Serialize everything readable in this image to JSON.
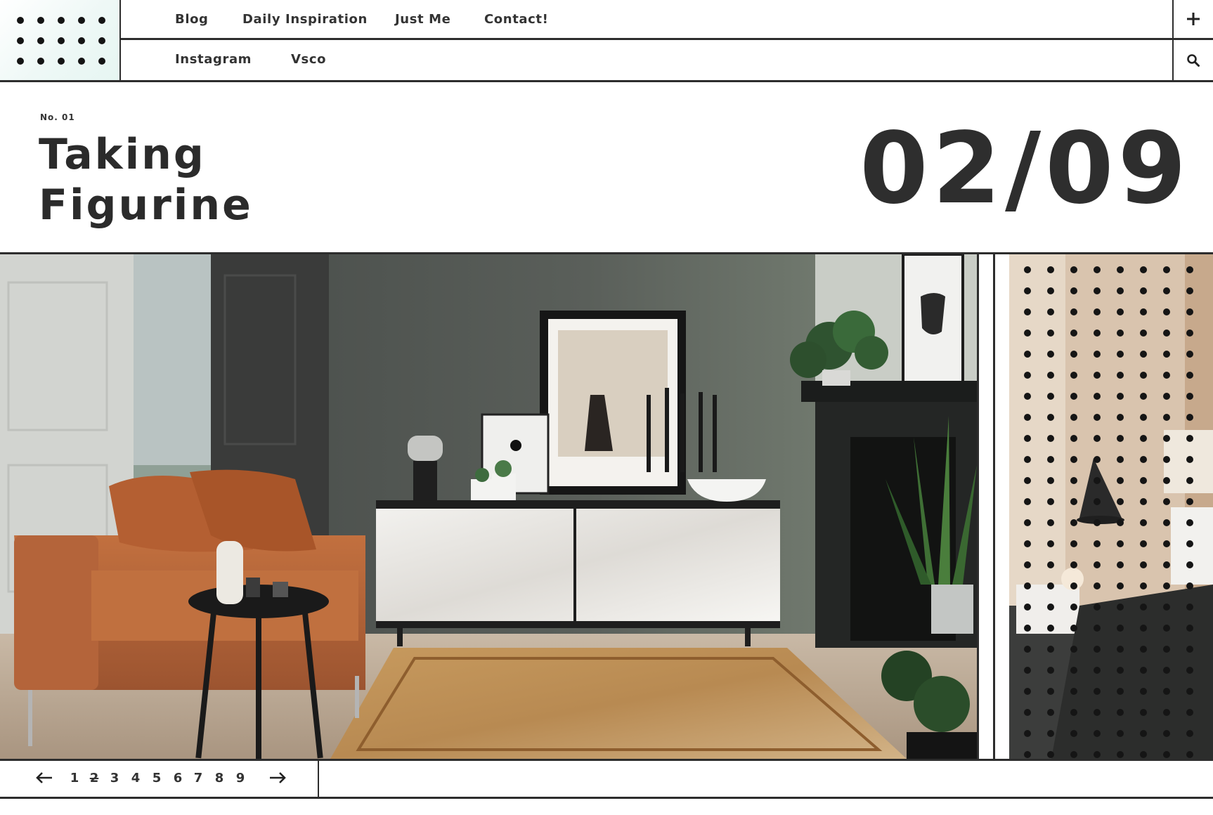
{
  "nav": {
    "row1": [
      "Blog",
      "Daily Inspiration",
      "Just Me",
      "Contact!"
    ],
    "row2": [
      "Instagram",
      "Vsco"
    ]
  },
  "icons": {
    "add": "plus-icon",
    "search": "search-icon",
    "logo": "dot-grid-logo-icon"
  },
  "feature": {
    "kicker": "No. 01",
    "title_line1": "Taking",
    "title_line2": "Figurine",
    "counter": "02/09"
  },
  "pagination": {
    "prev": "←",
    "next": "→",
    "pages": [
      "1",
      "2",
      "3",
      "4",
      "5",
      "6",
      "7",
      "8",
      "9"
    ],
    "current": "2"
  },
  "colors": {
    "ink": "#2b2b2b",
    "logo_tint": "#e6f6f2",
    "sofa": "#b8663a",
    "wall": "#4c514e"
  }
}
